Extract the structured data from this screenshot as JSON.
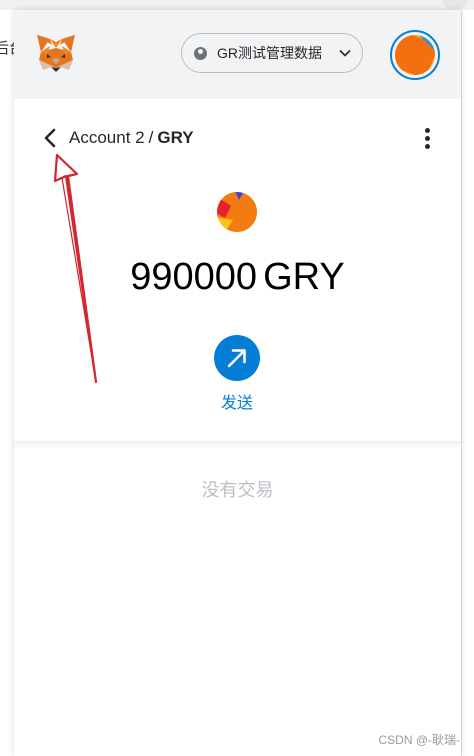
{
  "browser": {
    "left_partial_text": "后台"
  },
  "header": {
    "network": {
      "label": "GR测试管理数据"
    },
    "icons": {
      "logo": "metamask-fox-icon",
      "network_status": "network-status-dot-icon",
      "network_dropdown": "chevron-down-icon",
      "account": "account-identicon"
    }
  },
  "account_bar": {
    "account_name": "Account 2",
    "separator": "/",
    "token_name": "GRY",
    "icons": {
      "back": "chevron-left-icon",
      "menu": "kebab-menu-icon"
    }
  },
  "token_overview": {
    "balance": "990000",
    "symbol": "GRY",
    "send_label": "发送",
    "icons": {
      "token": "token-identicon",
      "send": "arrow-up-right-icon"
    }
  },
  "transactions": {
    "empty_text": "没有交易"
  },
  "watermark": "CSDN @-耿瑞-",
  "colors": {
    "header_bg": "#f2f3f4",
    "primary_blue": "#037dd6",
    "text_dark": "#24272a",
    "muted_text": "#bbc0c5",
    "annotation_red": "#d3262e"
  }
}
